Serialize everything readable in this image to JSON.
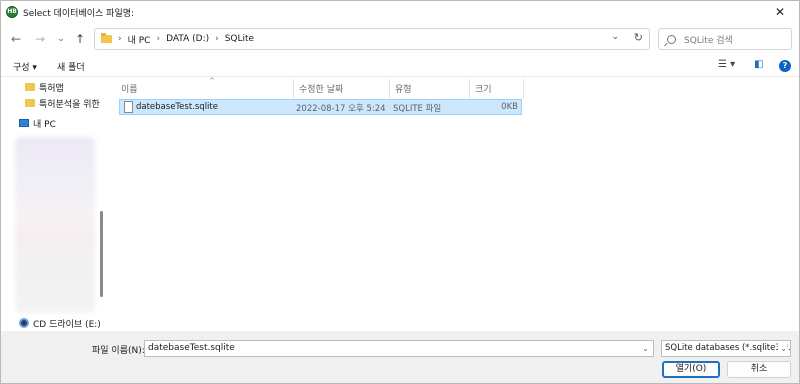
{
  "title_bar": {
    "title": "Select 데이터베이스 파일명:",
    "app_icon_text": "HB",
    "close_glyph": "✕"
  },
  "nav": {
    "back_glyph": "←",
    "forward_glyph": "→",
    "recent_glyph": "⌄",
    "up_glyph": "↑",
    "breadcrumbs": [
      "내 PC",
      "DATA (D:)",
      "SQLite"
    ],
    "breadcrumb_sep": "›",
    "dropdown_glyph": "⌄",
    "refresh_glyph": "↻",
    "search_placeholder": "SQLite 검색"
  },
  "commands": {
    "organize": "구성 ▾",
    "new_folder": "새 폴더",
    "view_glyph": "☰ ▾",
    "pane_glyph": "◧",
    "help_glyph": "?"
  },
  "sidebar": {
    "items": [
      {
        "label": "특허맵",
        "icon": "folder-icon"
      },
      {
        "label": "특허분석을 위한",
        "icon": "folder-icon"
      },
      {
        "label": "내 PC",
        "icon": "computer-icon"
      },
      {
        "label": "CD 드라이브 (E:)",
        "icon": "cd-drive-icon"
      }
    ]
  },
  "file_list": {
    "columns": [
      "이름",
      "수정한 날짜",
      "유형",
      "크기"
    ],
    "sort_glyph": "^",
    "rows": [
      {
        "name": "datebaseTest.sqlite",
        "modified": "2022-08-17 오후 5:24",
        "type": "SQLITE 파일",
        "size": "0KB"
      }
    ]
  },
  "bottom": {
    "filename_label": "파일 이름(N):",
    "filename_value": "datebaseTest.sqlite",
    "filetype_value": "SQLite databases (*.sqlite3;*.sq",
    "dropdown_glyph": "⌄",
    "open_button": "열기(O)",
    "cancel_button": "취소"
  },
  "colors": {
    "selection": "#cce8ff",
    "selection_border": "#99d1ff",
    "folder": "#f2c54b",
    "accent": "#0a64c4"
  }
}
